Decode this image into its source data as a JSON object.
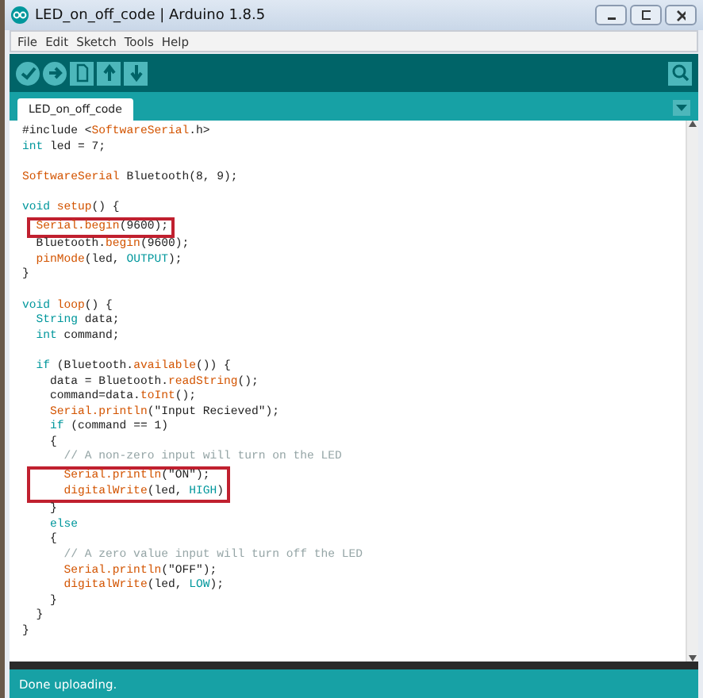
{
  "window": {
    "title": "LED_on_off_code | Arduino 1.8.5"
  },
  "menu": [
    "File",
    "Edit",
    "Sketch",
    "Tools",
    "Help"
  ],
  "tabs": [
    {
      "label": "LED_on_off_code",
      "selected": true
    }
  ],
  "code": {
    "lines": [
      {
        "kind": "code",
        "boxed": false,
        "segs": [
          {
            "text": "#include <",
            "kind": "plain"
          },
          {
            "text": "SoftwareSerial",
            "kind": "fn"
          },
          {
            "text": ".h>",
            "kind": "plain"
          }
        ]
      },
      {
        "kind": "code",
        "boxed": false,
        "segs": [
          {
            "text": "int",
            "kind": "kw"
          },
          {
            "text": " led = 7;",
            "kind": "plain"
          }
        ]
      },
      {
        "kind": "blank"
      },
      {
        "kind": "code",
        "boxed": false,
        "segs": [
          {
            "text": "SoftwareSerial",
            "kind": "fn"
          },
          {
            "text": " Bluetooth(8, 9);",
            "kind": "plain"
          }
        ]
      },
      {
        "kind": "blank"
      },
      {
        "kind": "code",
        "boxed": false,
        "segs": [
          {
            "text": "void",
            "kind": "kw"
          },
          {
            "text": " setup",
            "kind": "fn"
          },
          {
            "text": "() {",
            "kind": "plain"
          }
        ]
      },
      {
        "kind": "code",
        "boxed": true,
        "segs": [
          {
            "text": "  Serial.begin",
            "kind": "fn"
          },
          {
            "text": "(9600);",
            "kind": "plain"
          }
        ]
      },
      {
        "kind": "code",
        "boxed": false,
        "segs": [
          {
            "text": "  Bluetooth.",
            "kind": "plain"
          },
          {
            "text": "begin",
            "kind": "fn"
          },
          {
            "text": "(9600);",
            "kind": "plain"
          }
        ]
      },
      {
        "kind": "code",
        "boxed": false,
        "segs": [
          {
            "text": "  pinMode",
            "kind": "fn"
          },
          {
            "text": "(led, ",
            "kind": "plain"
          },
          {
            "text": "OUTPUT",
            "kind": "const"
          },
          {
            "text": ");",
            "kind": "plain"
          }
        ]
      },
      {
        "kind": "code",
        "boxed": false,
        "segs": [
          {
            "text": "}",
            "kind": "plain"
          }
        ]
      },
      {
        "kind": "blank"
      },
      {
        "kind": "code",
        "boxed": false,
        "segs": [
          {
            "text": "void",
            "kind": "kw"
          },
          {
            "text": " loop",
            "kind": "fn"
          },
          {
            "text": "() {",
            "kind": "plain"
          }
        ]
      },
      {
        "kind": "code",
        "boxed": false,
        "segs": [
          {
            "text": "  String",
            "kind": "kw"
          },
          {
            "text": " data;",
            "kind": "plain"
          }
        ]
      },
      {
        "kind": "code",
        "boxed": false,
        "segs": [
          {
            "text": "  int",
            "kind": "kw"
          },
          {
            "text": " command;",
            "kind": "plain"
          }
        ]
      },
      {
        "kind": "blank"
      },
      {
        "kind": "code",
        "boxed": false,
        "segs": [
          {
            "text": "  if",
            "kind": "kw"
          },
          {
            "text": " (Bluetooth.",
            "kind": "plain"
          },
          {
            "text": "available",
            "kind": "fn"
          },
          {
            "text": "()) {",
            "kind": "plain"
          }
        ]
      },
      {
        "kind": "code",
        "boxed": false,
        "segs": [
          {
            "text": "    data = Bluetooth.",
            "kind": "plain"
          },
          {
            "text": "readString",
            "kind": "fn"
          },
          {
            "text": "();",
            "kind": "plain"
          }
        ]
      },
      {
        "kind": "code",
        "boxed": false,
        "segs": [
          {
            "text": "    command=data.",
            "kind": "plain"
          },
          {
            "text": "toInt",
            "kind": "fn"
          },
          {
            "text": "();",
            "kind": "plain"
          }
        ]
      },
      {
        "kind": "code",
        "boxed": false,
        "segs": [
          {
            "text": "    Serial.println",
            "kind": "fn"
          },
          {
            "text": "(\"Input Recieved\");",
            "kind": "plain"
          }
        ]
      },
      {
        "kind": "code",
        "boxed": false,
        "segs": [
          {
            "text": "    if",
            "kind": "kw"
          },
          {
            "text": " (command == 1)",
            "kind": "plain"
          }
        ]
      },
      {
        "kind": "code",
        "boxed": false,
        "segs": [
          {
            "text": "    {",
            "kind": "plain"
          }
        ]
      },
      {
        "kind": "code",
        "boxed": false,
        "segs": [
          {
            "text": "      // A non-zero input will turn on the LED",
            "kind": "comment"
          }
        ]
      },
      {
        "kind": "code",
        "boxed": true,
        "segs": [
          {
            "text": "      Serial.println",
            "kind": "fn"
          },
          {
            "text": "(\"ON\");",
            "kind": "plain"
          }
        ]
      },
      {
        "kind": "code",
        "boxed": true,
        "segs": [
          {
            "text": "      digitalWrite",
            "kind": "fn"
          },
          {
            "text": "(led, ",
            "kind": "plain"
          },
          {
            "text": "HIGH",
            "kind": "const"
          },
          {
            "text": ")",
            "kind": "plain"
          }
        ]
      },
      {
        "kind": "code",
        "boxed": false,
        "segs": [
          {
            "text": "    }",
            "kind": "plain"
          }
        ]
      },
      {
        "kind": "code",
        "boxed": false,
        "segs": [
          {
            "text": "    else",
            "kind": "kw"
          }
        ]
      },
      {
        "kind": "code",
        "boxed": false,
        "segs": [
          {
            "text": "    {",
            "kind": "plain"
          }
        ]
      },
      {
        "kind": "code",
        "boxed": false,
        "segs": [
          {
            "text": "      // A zero value input will turn off the LED",
            "kind": "comment"
          }
        ]
      },
      {
        "kind": "code",
        "boxed": false,
        "segs": [
          {
            "text": "      Serial.println",
            "kind": "fn"
          },
          {
            "text": "(\"OFF\");",
            "kind": "plain"
          }
        ]
      },
      {
        "kind": "code",
        "boxed": false,
        "segs": [
          {
            "text": "      digitalWrite",
            "kind": "fn"
          },
          {
            "text": "(led, ",
            "kind": "plain"
          },
          {
            "text": "LOW",
            "kind": "const"
          },
          {
            "text": ");",
            "kind": "plain"
          }
        ]
      },
      {
        "kind": "code",
        "boxed": false,
        "segs": [
          {
            "text": "    }",
            "kind": "plain"
          }
        ]
      },
      {
        "kind": "code",
        "boxed": false,
        "segs": [
          {
            "text": "  }",
            "kind": "plain"
          }
        ]
      },
      {
        "kind": "code",
        "boxed": false,
        "segs": [
          {
            "text": "}",
            "kind": "plain"
          }
        ]
      }
    ]
  },
  "status_bar": {
    "text": "Done uploading."
  }
}
